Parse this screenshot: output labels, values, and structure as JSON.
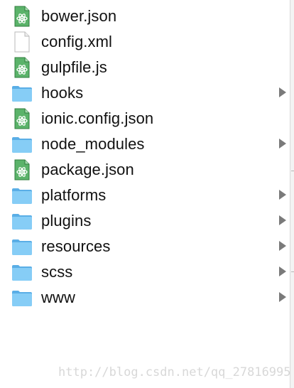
{
  "files": [
    {
      "name": "bower.json",
      "icon": "atom-json-file-icon",
      "kind": "file"
    },
    {
      "name": "config.xml",
      "icon": "blank-file-icon",
      "kind": "file"
    },
    {
      "name": "gulpfile.js",
      "icon": "atom-js-file-icon",
      "kind": "file"
    },
    {
      "name": "hooks",
      "icon": "folder-icon",
      "kind": "folder"
    },
    {
      "name": "ionic.config.json",
      "icon": "atom-json-file-icon",
      "kind": "file"
    },
    {
      "name": "node_modules",
      "icon": "folder-icon",
      "kind": "folder"
    },
    {
      "name": "package.json",
      "icon": "atom-json-file-icon",
      "kind": "file"
    },
    {
      "name": "platforms",
      "icon": "folder-icon",
      "kind": "folder"
    },
    {
      "name": "plugins",
      "icon": "folder-icon",
      "kind": "folder"
    },
    {
      "name": "resources",
      "icon": "folder-icon",
      "kind": "folder"
    },
    {
      "name": "scss",
      "icon": "folder-icon",
      "kind": "folder"
    },
    {
      "name": "www",
      "icon": "folder-icon",
      "kind": "folder"
    }
  ],
  "watermark": "http://blog.csdn.net/qq_27816995",
  "colors": {
    "folder": "#6cc3f3",
    "file_green": "#4caf50",
    "arrow": "#7a7a7a"
  }
}
